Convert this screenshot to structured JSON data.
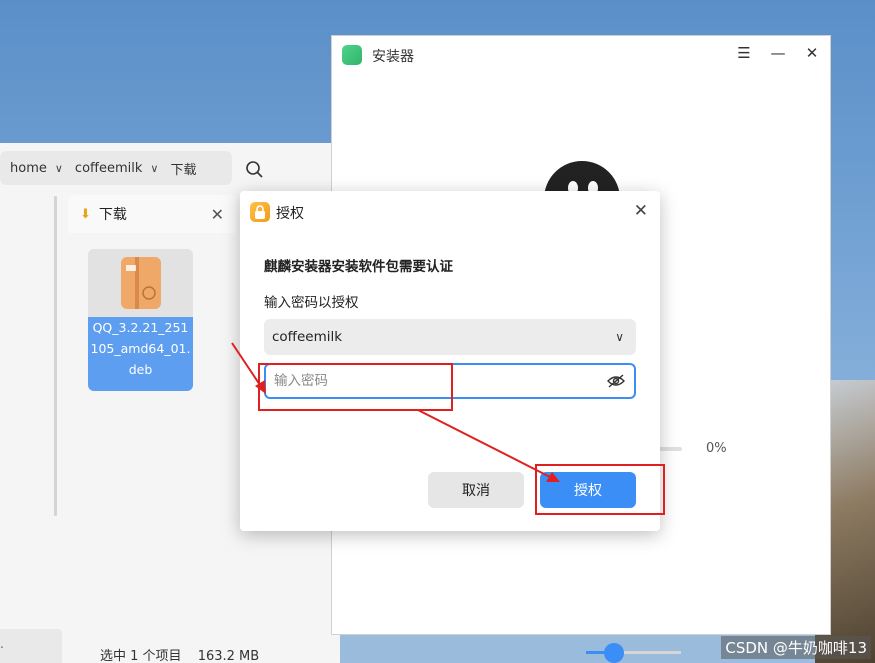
{
  "file_manager": {
    "path": [
      "home",
      "coffeemilk",
      "下载"
    ],
    "tab_label": "下载",
    "file_name": "QQ_3.2.21_251105_amd64_01.deb",
    "status_selected": "选中 1 个项目",
    "status_size": "163.2 MB",
    "left_strip_text": ".",
    "zoom_level": 0.3
  },
  "installer": {
    "title": "安装器",
    "progress_text": "0%",
    "progress": 0
  },
  "auth_dialog": {
    "title": "授权",
    "heading": "麒麟安装器安装软件包需要认证",
    "prompt": "输入密码以授权",
    "user_value": "coffeemilk",
    "password_placeholder": "输入密码",
    "password_value": "",
    "cancel_label": "取消",
    "ok_label": "授权"
  },
  "annotation_color": "#e02020",
  "accent_color": "#3a8ef5",
  "watermark": "CSDN @牛奶咖啡13"
}
